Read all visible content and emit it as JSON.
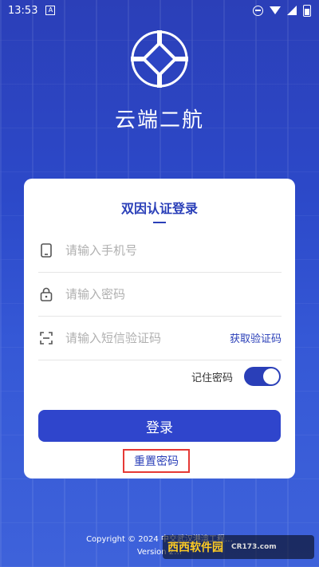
{
  "status_bar": {
    "time": "13:53",
    "notif_icon": "A"
  },
  "app": {
    "title": "云端二航"
  },
  "login": {
    "heading": "双因认证登录",
    "phone_placeholder": "请输入手机号",
    "password_placeholder": "请输入密码",
    "sms_placeholder": "请输入短信验证码",
    "get_code_label": "获取验证码",
    "remember_label": "记住密码",
    "remember_on": true,
    "submit_label": "登录",
    "reset_label": "重置密码"
  },
  "footer": {
    "copyright": "Copyright © 2024 中交武汉港湾工程…",
    "version": "Version 2…"
  },
  "watermark": {
    "brand": "西西软件园",
    "domain": "CR173.com"
  },
  "colors": {
    "primary": "#2a3fb8",
    "highlight_border": "#e53935"
  }
}
